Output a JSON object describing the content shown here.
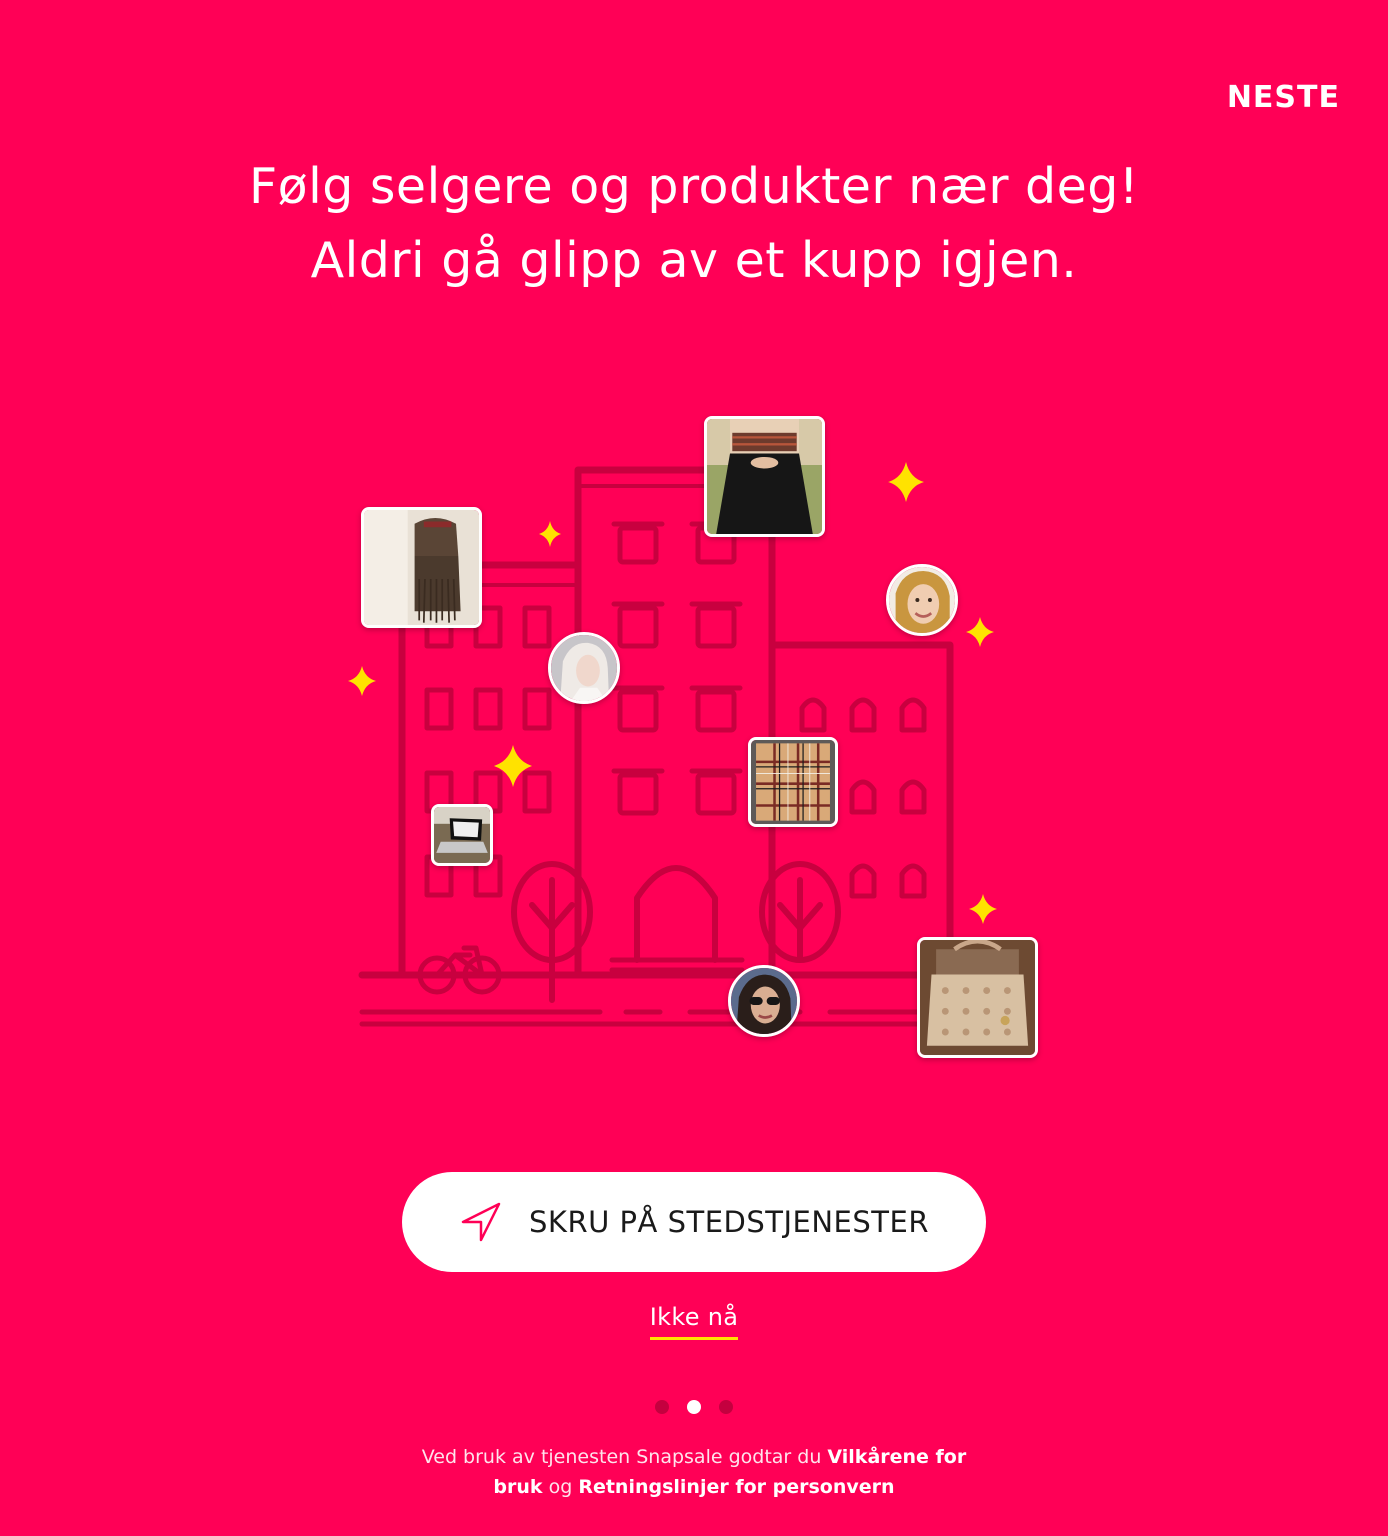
{
  "header": {
    "next_label": "NESTE"
  },
  "headline": {
    "line1": "Følg selgere og produkter nær deg!",
    "line2": "Aldri gå glipp av et kupp igjen."
  },
  "illustration": {
    "items": [
      {
        "kind": "photo",
        "subject": "backpack-photo"
      },
      {
        "kind": "photo",
        "subject": "dress-photo"
      },
      {
        "kind": "avatar",
        "subject": "user-avatar"
      },
      {
        "kind": "avatar",
        "subject": "user-avatar"
      },
      {
        "kind": "photo",
        "subject": "scarf-photo"
      },
      {
        "kind": "photo",
        "subject": "laptop-photo"
      },
      {
        "kind": "avatar",
        "subject": "user-avatar"
      },
      {
        "kind": "photo",
        "subject": "handbag-photo"
      }
    ],
    "sparkle_color": "#FFE200",
    "line_color": "#C8003F"
  },
  "cta": {
    "label": "SKRU PÅ STEDSTJENESTER",
    "icon": "location-arrow-icon"
  },
  "skip": {
    "label": "Ikke nå"
  },
  "pager": {
    "total": 3,
    "active_index": 1
  },
  "legal": {
    "prefix": "Ved bruk av tjenesten Snapsale godtar du ",
    "terms_link": "Vilkårene for bruk",
    "conjunction": " og ",
    "privacy_link": "Retningslinjer for personvern"
  },
  "colors": {
    "background": "#FF0056",
    "accent_yellow": "#FFE200",
    "button_bg": "#FFFFFF"
  }
}
